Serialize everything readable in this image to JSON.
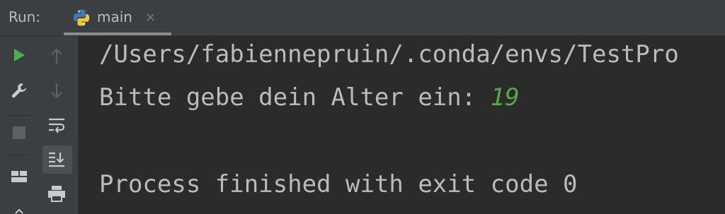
{
  "run_panel": {
    "label": "Run:",
    "tab": {
      "label": "main",
      "icon": "python-icon",
      "close_glyph": "×"
    }
  },
  "toolbar_left": [
    {
      "icon": "run-icon",
      "color": "#4caf50"
    },
    {
      "icon": "wrench-icon"
    },
    {
      "icon": "stop-icon"
    },
    {
      "icon": "layout-icon"
    }
  ],
  "toolbar_right": [
    {
      "icon": "up-arrow-icon"
    },
    {
      "icon": "down-arrow-icon"
    },
    {
      "icon": "soft-wrap-icon"
    },
    {
      "icon": "scroll-to-end-icon",
      "pressed": true
    },
    {
      "icon": "print-icon"
    }
  ],
  "console": {
    "path_line": "/Users/fabiennepruin/.conda/envs/TestPro",
    "prompt_line": "Bitte gebe dein Alter ein: ",
    "input_value": "19",
    "exit_line": "Process finished with exit code 0",
    "colors": {
      "text": "#bbbbbb",
      "input": "#57a64a"
    }
  }
}
